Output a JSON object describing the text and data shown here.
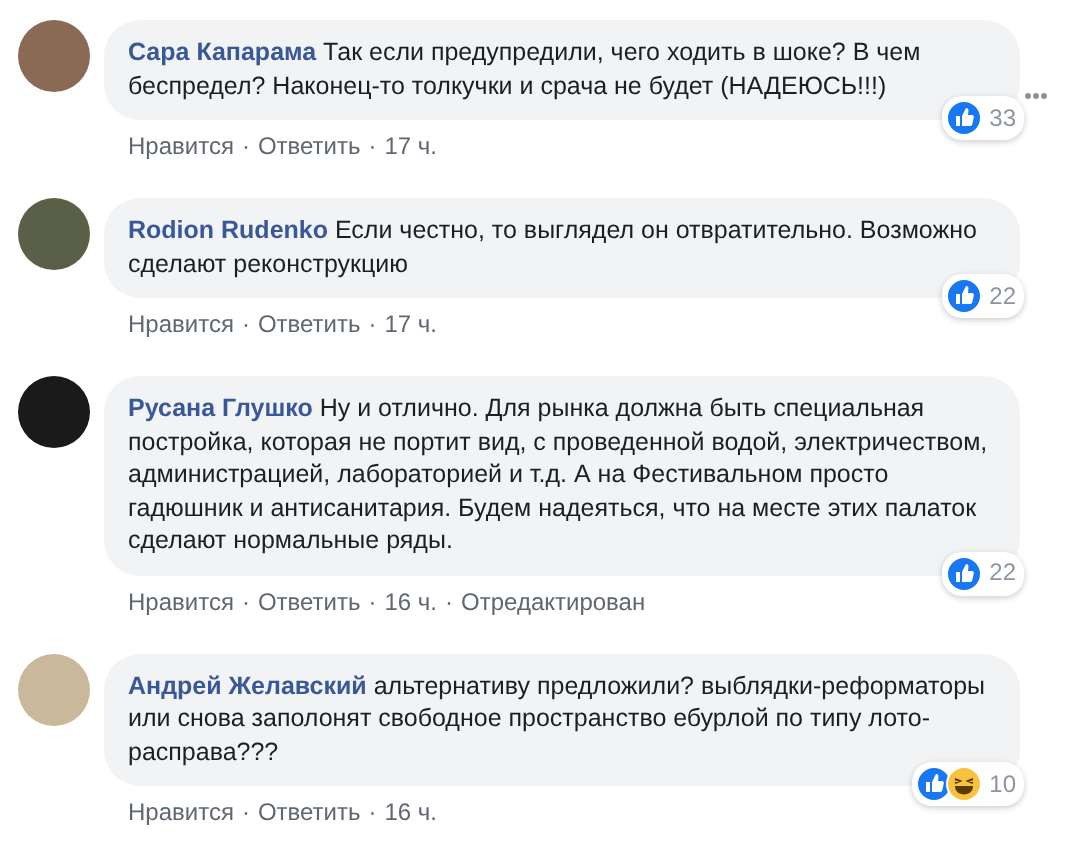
{
  "comments": [
    {
      "author": "Сара Капарама",
      "text": "Так если предупредили, чего ходить в шоке? В чем беспредел? Наконец-то толкучки и срача не будет (НАДЕЮСЬ!!!)",
      "reactions": [
        {
          "kind": "like"
        }
      ],
      "reaction_count": "33",
      "actions": [
        {
          "kind": "like",
          "text": "Нравится"
        },
        {
          "kind": "dot",
          "text": "·"
        },
        {
          "kind": "reply",
          "text": "Ответить"
        },
        {
          "kind": "dot",
          "text": "·"
        },
        {
          "kind": "time",
          "text": "17 ч."
        }
      ],
      "more_menu": true
    },
    {
      "author": "Rodion Rudenko",
      "text": "Если честно, то выглядел он отвратительно. Возможно сделают реконструкцию",
      "reactions": [
        {
          "kind": "like"
        }
      ],
      "reaction_count": "22",
      "actions": [
        {
          "kind": "like",
          "text": "Нравится"
        },
        {
          "kind": "dot",
          "text": "·"
        },
        {
          "kind": "reply",
          "text": "Ответить"
        },
        {
          "kind": "dot",
          "text": "·"
        },
        {
          "kind": "time",
          "text": "17 ч."
        }
      ],
      "more_menu": false
    },
    {
      "author": "Русана Глушко",
      "text": "Ну и отлично. Для рынка должна быть специальная постройка, которая не портит вид, с проведенной водой, электричеством, администрацией, лабораторией и т.д. А на Фестивальном просто гадюшник и антисанитария. Будем надеяться, что на месте этих палаток сделают нормальные ряды.",
      "reactions": [
        {
          "kind": "like"
        }
      ],
      "reaction_count": "22",
      "actions": [
        {
          "kind": "like",
          "text": "Нравится"
        },
        {
          "kind": "dot",
          "text": "·"
        },
        {
          "kind": "reply",
          "text": "Ответить"
        },
        {
          "kind": "dot",
          "text": "·"
        },
        {
          "kind": "time",
          "text": "16 ч."
        },
        {
          "kind": "dot",
          "text": "·"
        },
        {
          "kind": "edited",
          "text": "Отредактирован"
        }
      ],
      "more_menu": false
    },
    {
      "author": "Андрей Желавский",
      "text": "альтернативу предложили? выблядки-реформаторы или снова заполонят свободное пространство ебурлой по типу лото-расправа???",
      "reactions": [
        {
          "kind": "like"
        },
        {
          "kind": "haha"
        }
      ],
      "reaction_count": "10",
      "actions": [
        {
          "kind": "like",
          "text": "Нравится"
        },
        {
          "kind": "dot",
          "text": "·"
        },
        {
          "kind": "reply",
          "text": "Ответить"
        },
        {
          "kind": "dot",
          "text": "·"
        },
        {
          "kind": "time",
          "text": "16 ч."
        }
      ],
      "more_menu": false
    }
  ]
}
